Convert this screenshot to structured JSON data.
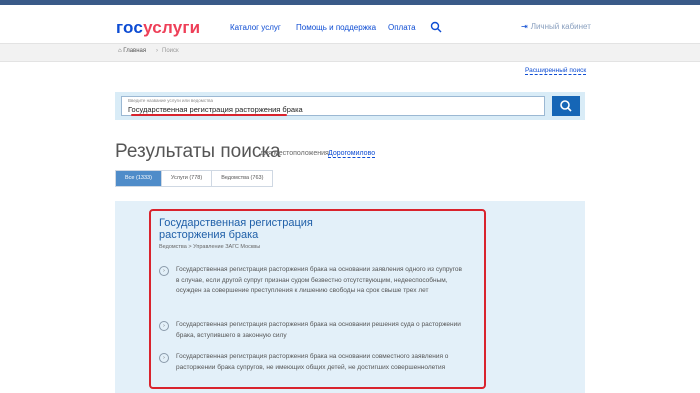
{
  "header": {
    "logo_part1": "гос",
    "logo_part2": "услуги",
    "nav": [
      "Каталог услуг",
      "Помощь и поддержка",
      "Оплата"
    ],
    "cabinet_label": "Личный кабинет"
  },
  "breadcrumb": {
    "home": "Главная",
    "current": "Поиск"
  },
  "advanced_search": "Расширенный поиск",
  "search": {
    "hint": "Введите название услуги или ведомства",
    "query": "Государственная регистрация расторжения брака"
  },
  "results": {
    "title": "Результаты поиска",
    "location_label": "для местоположения",
    "location_value": "Дорогомилово",
    "tabs": [
      "Все (1333)",
      "Услуги (778)",
      "Ведомства (763)"
    ]
  },
  "result_item": {
    "title": "Государственная регистрация расторжения брака",
    "department": "Ведомства > Управление ЗАГС Москвы",
    "subitems": [
      "Государственная регистрация расторжения брака на основании заявления одного из супругов в случае, если другой супруг признан судом безвестно отсутствующим, недееспособным, осужден за совершение преступления к лишению свободы на срок свыше трех лет",
      "Государственная регистрация расторжения брака на основании решения суда о расторжении брака, вступившего в законную силу",
      "Государственная регистрация расторжения брака на основании совместного заявления о расторжении брака супругов, не имеющих общих детей, не достигших совершеннолетия"
    ]
  },
  "colors": {
    "brand_blue": "#0d4cd3",
    "brand_red": "#ee3f58",
    "highlight_red": "#d9232d",
    "search_button": "#1666b6"
  }
}
